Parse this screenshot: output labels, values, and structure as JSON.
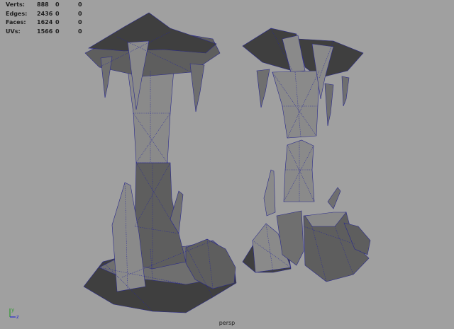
{
  "hud": {
    "rows": [
      {
        "label": "Verts:",
        "v1": "888",
        "v2": "0",
        "v3": "0"
      },
      {
        "label": "Edges:",
        "v1": "2436",
        "v2": "0",
        "v3": "0"
      },
      {
        "label": "Faces:",
        "v1": "1624",
        "v2": "0",
        "v3": "0"
      },
      {
        "label": "UVs:",
        "v1": "1566",
        "v2": "0",
        "v3": "0"
      }
    ]
  },
  "camera": "persp",
  "axis": {
    "y": "y",
    "z": "z"
  },
  "colors": {
    "background": "#a0a0a0",
    "wireframe": "#26269a",
    "hud_text": "#1f1f1f"
  }
}
